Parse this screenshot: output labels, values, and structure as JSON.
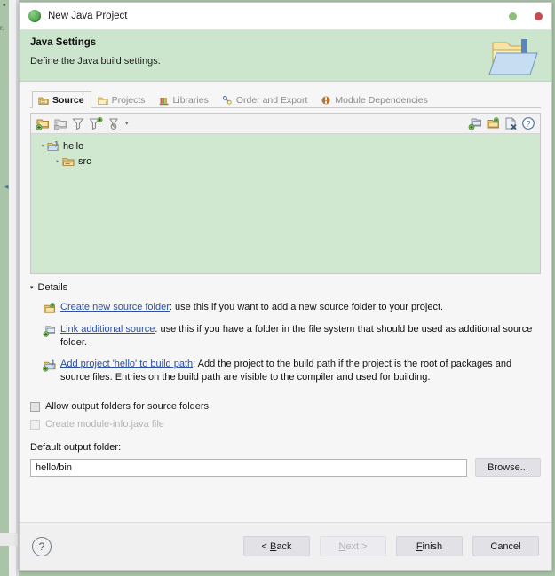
{
  "window": {
    "title": "New Java Project",
    "icon": "eclipse-java-icon",
    "controls": {
      "minimize": "minimize-dot",
      "close": "close-dot"
    }
  },
  "banner": {
    "title": "Java Settings",
    "subtitle": "Define the Java build settings.",
    "icon": "java-folder-banner-icon"
  },
  "tabs": [
    {
      "label": "Source",
      "icon": "source-folder-icon",
      "active": true
    },
    {
      "label": "Projects",
      "icon": "projects-icon",
      "active": false
    },
    {
      "label": "Libraries",
      "icon": "libraries-icon",
      "active": false
    },
    {
      "label": "Order and Export",
      "icon": "order-export-icon",
      "active": false
    },
    {
      "label": "Module Dependencies",
      "icon": "module-dependencies-icon",
      "active": false
    }
  ],
  "tree_toolbar": {
    "left_icons": [
      "add-source-folder-icon",
      "remove-source-folder-icon",
      "filter-icon",
      "add-filter-icon",
      "clear-filter-icon"
    ],
    "menu_caret": "▾",
    "right_icons": [
      "link-source-icon",
      "create-folder-icon",
      "remove-entry-icon",
      "help-icon"
    ]
  },
  "tree": {
    "items": [
      {
        "label": "hello",
        "icon": "java-project-icon",
        "indent": 0,
        "expanded": true,
        "twisty": "▾"
      },
      {
        "label": "src",
        "icon": "source-folder-icon",
        "indent": 1,
        "expanded": false,
        "twisty": "▸"
      }
    ]
  },
  "details": {
    "twisty": "▾",
    "header": "Details",
    "rows": [
      {
        "icon": "create-source-folder-icon",
        "link": "Create new source folder",
        "text": ": use this if you want to add a new source folder to your project."
      },
      {
        "icon": "link-source-icon",
        "link": "Link additional source",
        "text": ": use this if you have a folder in the file system that should be used as additional source folder."
      },
      {
        "icon": "add-to-build-path-icon",
        "link": "Add project 'hello' to build path",
        "text": ": Add the project to the build path if the project is the root of packages and source files. Entries on the build path are visible to the compiler and used for building."
      }
    ]
  },
  "options": [
    {
      "label": "Allow output folders for source folders",
      "checked": false,
      "disabled": false
    },
    {
      "label": "Create module-info.java file",
      "checked": false,
      "disabled": true
    }
  ],
  "output_folder": {
    "label": "Default output folder:",
    "value": "hello/bin",
    "browse_label": "Browse..."
  },
  "footer": {
    "help": "?",
    "buttons": [
      {
        "label": "< Back",
        "disabled": false
      },
      {
        "label": "Next >",
        "disabled": true
      },
      {
        "label": "Finish",
        "disabled": false
      },
      {
        "label": "Cancel",
        "disabled": false
      }
    ]
  },
  "backdrop": {
    "left_text": "r.",
    "tick": "▾",
    "arrow": "◂"
  },
  "colors": {
    "banner": "#cce5cd",
    "tree_background": "#cfe8cf",
    "link": "#2b50a8",
    "workbench_background": "#a9c4a6",
    "dot_green": "#8cbf7e",
    "dot_red": "#c94a4f"
  }
}
